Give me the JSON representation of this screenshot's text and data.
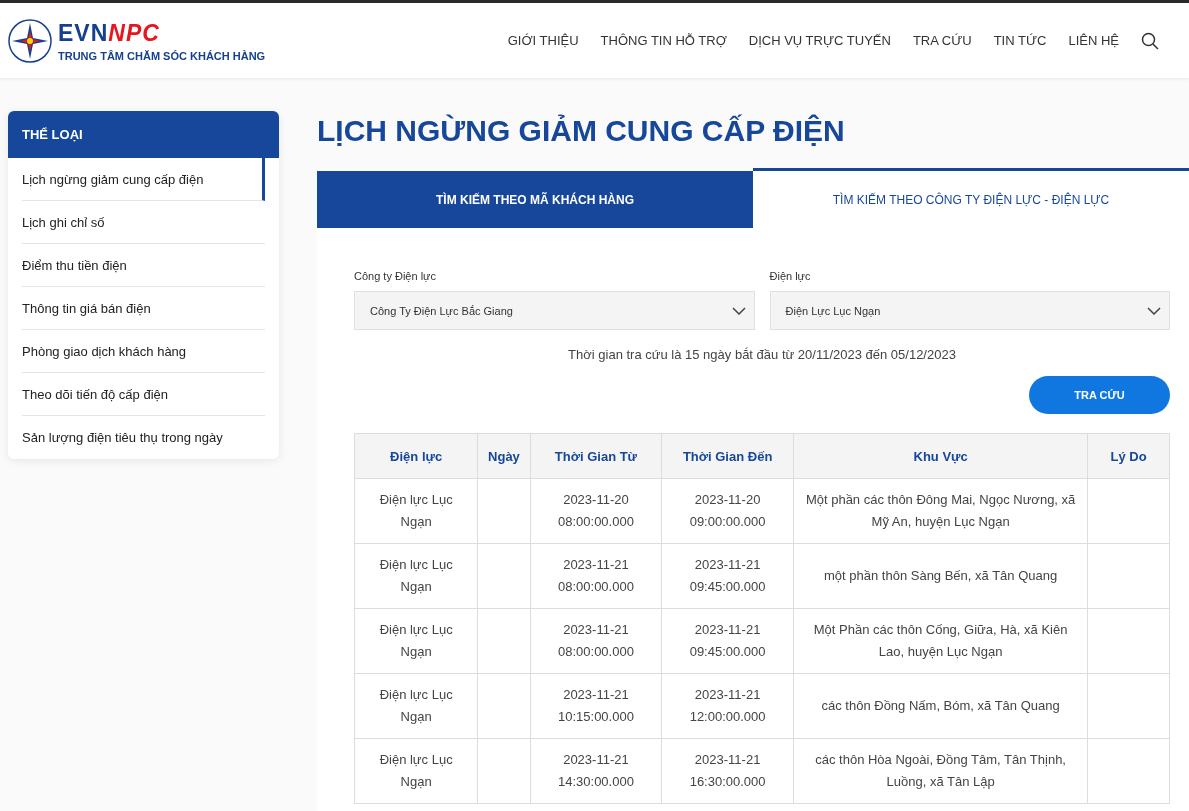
{
  "header": {
    "brand_evn": "EVN",
    "brand_npc": "NPC",
    "brand_subtitle": "TRUNG TÂM CHĂM SÓC KHÁCH HÀNG",
    "nav": [
      "GIỚI THIỆU",
      "THÔNG TIN HỖ TRỢ",
      "DỊCH VỤ TRỰC TUYẾN",
      "TRA CỨU",
      "TIN TỨC",
      "LIÊN HỆ"
    ]
  },
  "sidebar": {
    "title": "THỂ LOẠI",
    "items": [
      {
        "label": "Lịch ngừng giảm cung cấp điện",
        "selected": true
      },
      {
        "label": "Lịch ghi chỉ số",
        "selected": false
      },
      {
        "label": "Điểm thu tiền điện",
        "selected": false
      },
      {
        "label": "Thông tin giá bán điện",
        "selected": false
      },
      {
        "label": "Phòng giao dịch khách hàng",
        "selected": false
      },
      {
        "label": "Theo dõi tiến độ cấp điện",
        "selected": false
      },
      {
        "label": "Sản lượng điện tiêu thụ trong ngày",
        "selected": false
      }
    ]
  },
  "page_title": "LỊCH NGỪNG GIẢM CUNG CẤP ĐIỆN",
  "tabs": [
    {
      "label": "TÌM KIẾM THEO MÃ KHÁCH HÀNG",
      "selected": true
    },
    {
      "label": "TÌM KIẾM THEO CÔNG TY ĐIỆN LỰC - ĐIỆN LỰC",
      "selected": false
    }
  ],
  "filters": [
    {
      "label": "Công ty Điện lực",
      "value": "Công Ty Điện Lực Bắc Giang"
    },
    {
      "label": "Điện lực",
      "value": "Điện Lực Lục Ngạn"
    }
  ],
  "note": "Thời gian tra cứu là 15 ngày bắt đầu từ 20/11/2023 đến 05/12/2023",
  "search_button": "TRA CỨU",
  "table": {
    "columns": [
      "Điện lực",
      "Ngày",
      "Thời Gian Từ",
      "Thời Gian Đến",
      "Khu Vực",
      "Lý Do"
    ],
    "rows": [
      [
        "Điện lực Lục Ngạn",
        "",
        "2023-11-20 08:00:00.000",
        "2023-11-20 09:00:00.000",
        "Một phần các thôn Đông Mai, Ngọc Nương, xã Mỹ An, huyện Lục Ngạn",
        ""
      ],
      [
        "Điện lực Lục Ngạn",
        "",
        "2023-11-21 08:00:00.000",
        "2023-11-21 09:45:00.000",
        "một phần thôn Sàng Bến, xã Tân Quang",
        ""
      ],
      [
        "Điện lực Lục Ngạn",
        "",
        "2023-11-21 08:00:00.000",
        "2023-11-21 09:45:00.000",
        "Một Phần các thôn Cống, Giữa, Hà, xã Kiên Lao, huyện Lục Ngạn",
        ""
      ],
      [
        "Điện lực Lục Ngạn",
        "",
        "2023-11-21 10:15:00.000",
        "2023-11-21 12:00:00.000",
        "các thôn Đồng Nấm, Bóm, xã Tân Quang",
        ""
      ],
      [
        "Điện lực Lục Ngạn",
        "",
        "2023-11-21 14:30:00.000",
        "2023-11-21 16:30:00.000",
        "các thôn Hòa Ngoài, Đồng Tâm, Tân Thịnh, Luồng, xã Tân Lập",
        ""
      ]
    ]
  }
}
